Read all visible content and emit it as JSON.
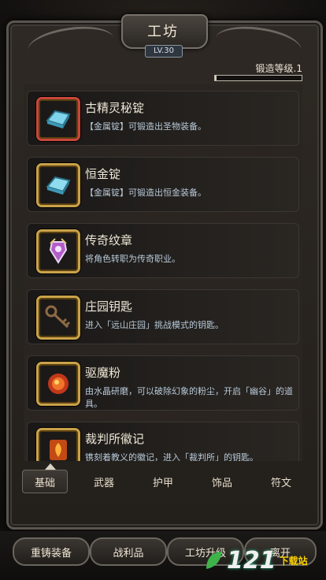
{
  "header": {
    "title": "工坊",
    "level": "LV.30",
    "forge_level_label": "锻造等级.1",
    "forge_progress": 0.02
  },
  "items": [
    {
      "name": "古精灵秘锭",
      "desc": "【金属锭】可锻造出圣物装备。",
      "icon": "blue-ingot-icon",
      "frame_color": "#c9463a"
    },
    {
      "name": "恒金锭",
      "desc": "【金属锭】可锻造出恒金装备。",
      "icon": "blue-ingot-icon",
      "frame_color": "#c9a24a"
    },
    {
      "name": "传奇纹章",
      "desc": "将角色转职为传奇职业。",
      "icon": "crest-emblem-icon",
      "frame_color": "#c9a24a"
    },
    {
      "name": "庄园钥匙",
      "desc": "进入「远山庄园」挑战模式的钥匙。",
      "icon": "key-icon",
      "frame_color": "#c9a24a"
    },
    {
      "name": "驱魔粉",
      "desc": "由水晶研磨，可以破除幻象的粉尘，开启「幽谷」的道具。",
      "icon": "fire-powder-icon",
      "frame_color": "#c9a24a"
    },
    {
      "name": "裁判所徽记",
      "desc": "镌刻着教义的徽记，进入「裁判所」的钥匙。",
      "icon": "fire-sigil-icon",
      "frame_color": "#c9a24a"
    }
  ],
  "tabs": [
    "基础",
    "武器",
    "护甲",
    "饰品",
    "符文"
  ],
  "active_tab": 0,
  "bottom_buttons": [
    "重铸装备",
    "战利品",
    "工坊升级",
    "离开"
  ],
  "watermark": {
    "number": "121",
    "text": "下载站"
  }
}
